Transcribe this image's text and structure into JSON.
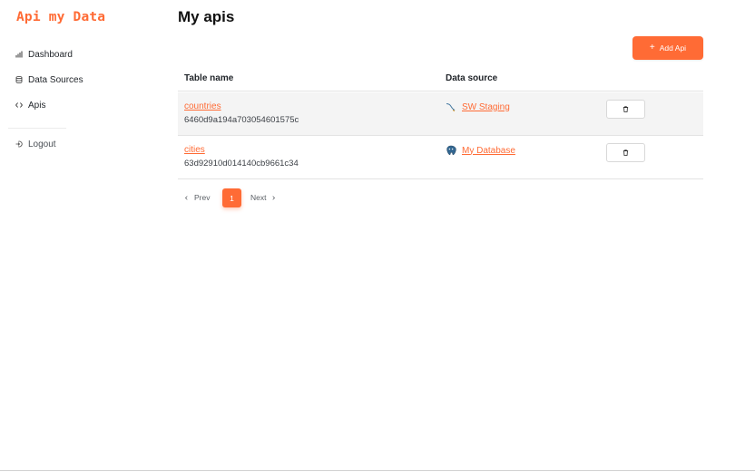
{
  "app": {
    "logo": "Api my Data",
    "brand_color": "#ff6b35"
  },
  "sidebar": {
    "items": [
      {
        "label": "Dashboard",
        "icon": "bar-chart-icon"
      },
      {
        "label": "Data Sources",
        "icon": "database-icon"
      },
      {
        "label": "Apis",
        "icon": "code-brackets-icon"
      }
    ],
    "logout_label": "Logout",
    "logout_icon": "logout-icon"
  },
  "main": {
    "title": "My apis",
    "add_button_label": "Add Api",
    "table": {
      "columns": [
        "Table name",
        "Data source"
      ],
      "rows": [
        {
          "name": "countries",
          "id": "6460d9a194a703054601575c",
          "source": "SW Staging",
          "source_icon": "mysql-icon",
          "action_icon": "trash-icon"
        },
        {
          "name": "cities",
          "id": "63d92910d014140cb9661c34",
          "source": "My Database",
          "source_icon": "postgresql-icon",
          "action_icon": "trash-icon"
        }
      ]
    },
    "pagination": {
      "prev_label": "Prev",
      "current_page": "1",
      "next_label": "Next"
    }
  }
}
